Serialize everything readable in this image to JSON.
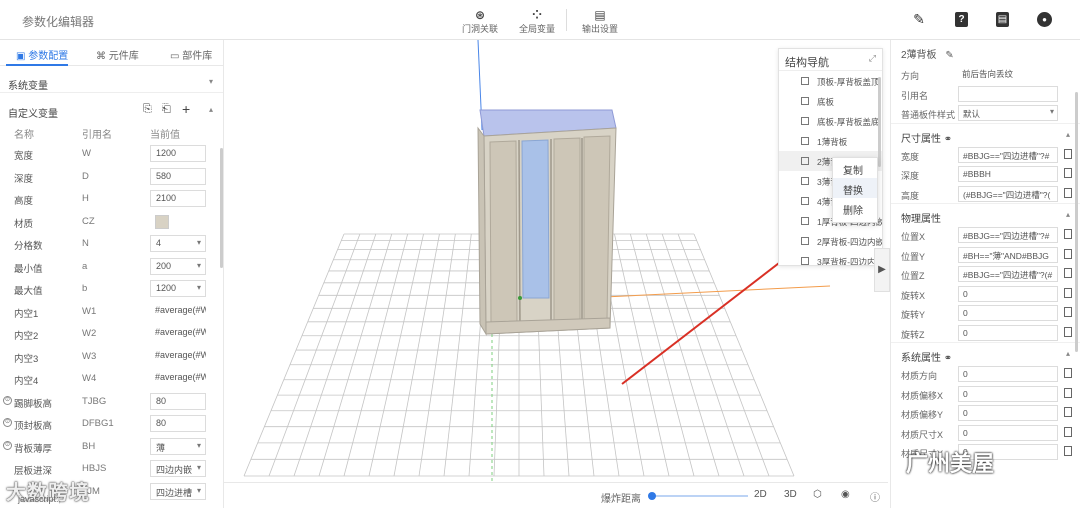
{
  "app": {
    "title": "参数化编辑器"
  },
  "toolbar": {
    "tools": [
      {
        "label": "门洞关联",
        "icon": "door-link-icon"
      },
      {
        "label": "全局变量",
        "icon": "grid-icon"
      },
      {
        "label": "输出设置",
        "icon": "export-doc-icon"
      }
    ],
    "right_icons": [
      "pencil-icon",
      "help-icon",
      "document-icon",
      "settings-icon"
    ]
  },
  "left_panel": {
    "tabs": [
      "参数配置",
      "元件库",
      "部件库"
    ],
    "system_vars_label": "系统变量",
    "custom_vars_label": "自定义变量",
    "columns": [
      "名称",
      "引用名",
      "当前值"
    ],
    "rows": [
      {
        "name": "宽度",
        "ref": "W",
        "value": "1200",
        "kind": "input"
      },
      {
        "name": "深度",
        "ref": "D",
        "value": "580",
        "kind": "input"
      },
      {
        "name": "高度",
        "ref": "H",
        "value": "2100",
        "kind": "input"
      },
      {
        "name": "材质",
        "ref": "CZ",
        "value": "",
        "kind": "swatch"
      },
      {
        "name": "分格数",
        "ref": "N",
        "value": "4",
        "kind": "select"
      },
      {
        "name": "最小值",
        "ref": "a",
        "value": "200",
        "kind": "select"
      },
      {
        "name": "最大值",
        "ref": "b",
        "value": "1200",
        "kind": "select"
      },
      {
        "name": "内空1",
        "ref": "W1",
        "value": "#average(#W...",
        "kind": "text"
      },
      {
        "name": "内空2",
        "ref": "W2",
        "value": "#average(#W...",
        "kind": "text"
      },
      {
        "name": "内空3",
        "ref": "W3",
        "value": "#average(#W...",
        "kind": "text"
      },
      {
        "name": "内空4",
        "ref": "W4",
        "value": "#average(#W...",
        "kind": "text"
      },
      {
        "name": "踢脚板高",
        "ref": "TJBG",
        "value": "80",
        "kind": "input",
        "circle": true
      },
      {
        "name": "顶封板高",
        "ref": "DFBG1",
        "value": "80",
        "kind": "input",
        "circle": true
      },
      {
        "name": "背板薄厚",
        "ref": "BH",
        "value": "薄",
        "kind": "select",
        "circle": true
      },
      {
        "name": "层板进深",
        "ref": "HBJS",
        "value": "四边内嵌",
        "kind": "select"
      },
      {
        "name": "",
        "ref": "bJM",
        "value": "四边进槽",
        "kind": "select"
      }
    ]
  },
  "struct_nav": {
    "title": "结构导航",
    "items": [
      "顶板-厚背板盖顶",
      "底板",
      "底板-厚背板盖底",
      "1薄背板",
      "2薄背板",
      "3薄背板",
      "4薄背板",
      "1厚背板-四边内嵌",
      "2厚背板-四边内嵌",
      "3厚背板-四边内嵌"
    ]
  },
  "context_menu": {
    "items": [
      "复制",
      "替换",
      "删除"
    ]
  },
  "right_panel": {
    "header": "2薄背板",
    "basic": [
      {
        "label": "方向",
        "value": "前后告向丢纹",
        "kind": "plain"
      },
      {
        "label": "引用名",
        "value": "",
        "kind": "input",
        "help": true
      },
      {
        "label": "普通板件样式",
        "value": "默认",
        "kind": "select"
      }
    ],
    "size_title": "尺寸属性",
    "size": [
      {
        "label": "宽度",
        "value": "#BBJG==\"四边进槽\"?#"
      },
      {
        "label": "深度",
        "value": "#BBBH"
      },
      {
        "label": "高度",
        "value": "(#BBJG==\"四边进槽\"?("
      }
    ],
    "physics_title": "物理属性",
    "physics": [
      {
        "label": "位置X",
        "value": "#BBJG==\"四边进槽\"?#",
        "red": "X"
      },
      {
        "label": "位置Y",
        "value": "#BH==\"薄\"AND#BBJG",
        "red": ""
      },
      {
        "label": "位置Z",
        "value": "#BBJG==\"四边进槽\"?(#",
        "red": ""
      },
      {
        "label": "旋转X",
        "value": "0",
        "red": "X"
      },
      {
        "label": "旋转Y",
        "value": "0",
        "red": ""
      },
      {
        "label": "旋转Z",
        "value": "0",
        "red": ""
      }
    ],
    "system_title": "系统属性",
    "system": [
      {
        "label": "材质方向",
        "value": "0"
      },
      {
        "label": "材质偏移X",
        "value": "0"
      },
      {
        "label": "材质偏移Y",
        "value": "0"
      },
      {
        "label": "材质尺寸X",
        "value": "0"
      },
      {
        "label": "材质尺寸Y",
        "value": "0"
      }
    ]
  },
  "bottom_bar": {
    "explode_label": "爆炸距离",
    "explode_value": 0,
    "buttons": [
      "2D",
      "3D"
    ],
    "icons": [
      "cube-icon",
      "eye-icon",
      "info-icon"
    ]
  },
  "status": {
    "text": "javascript:;"
  },
  "watermarks": {
    "left": "大数跨境",
    "right": "广州美屋"
  }
}
